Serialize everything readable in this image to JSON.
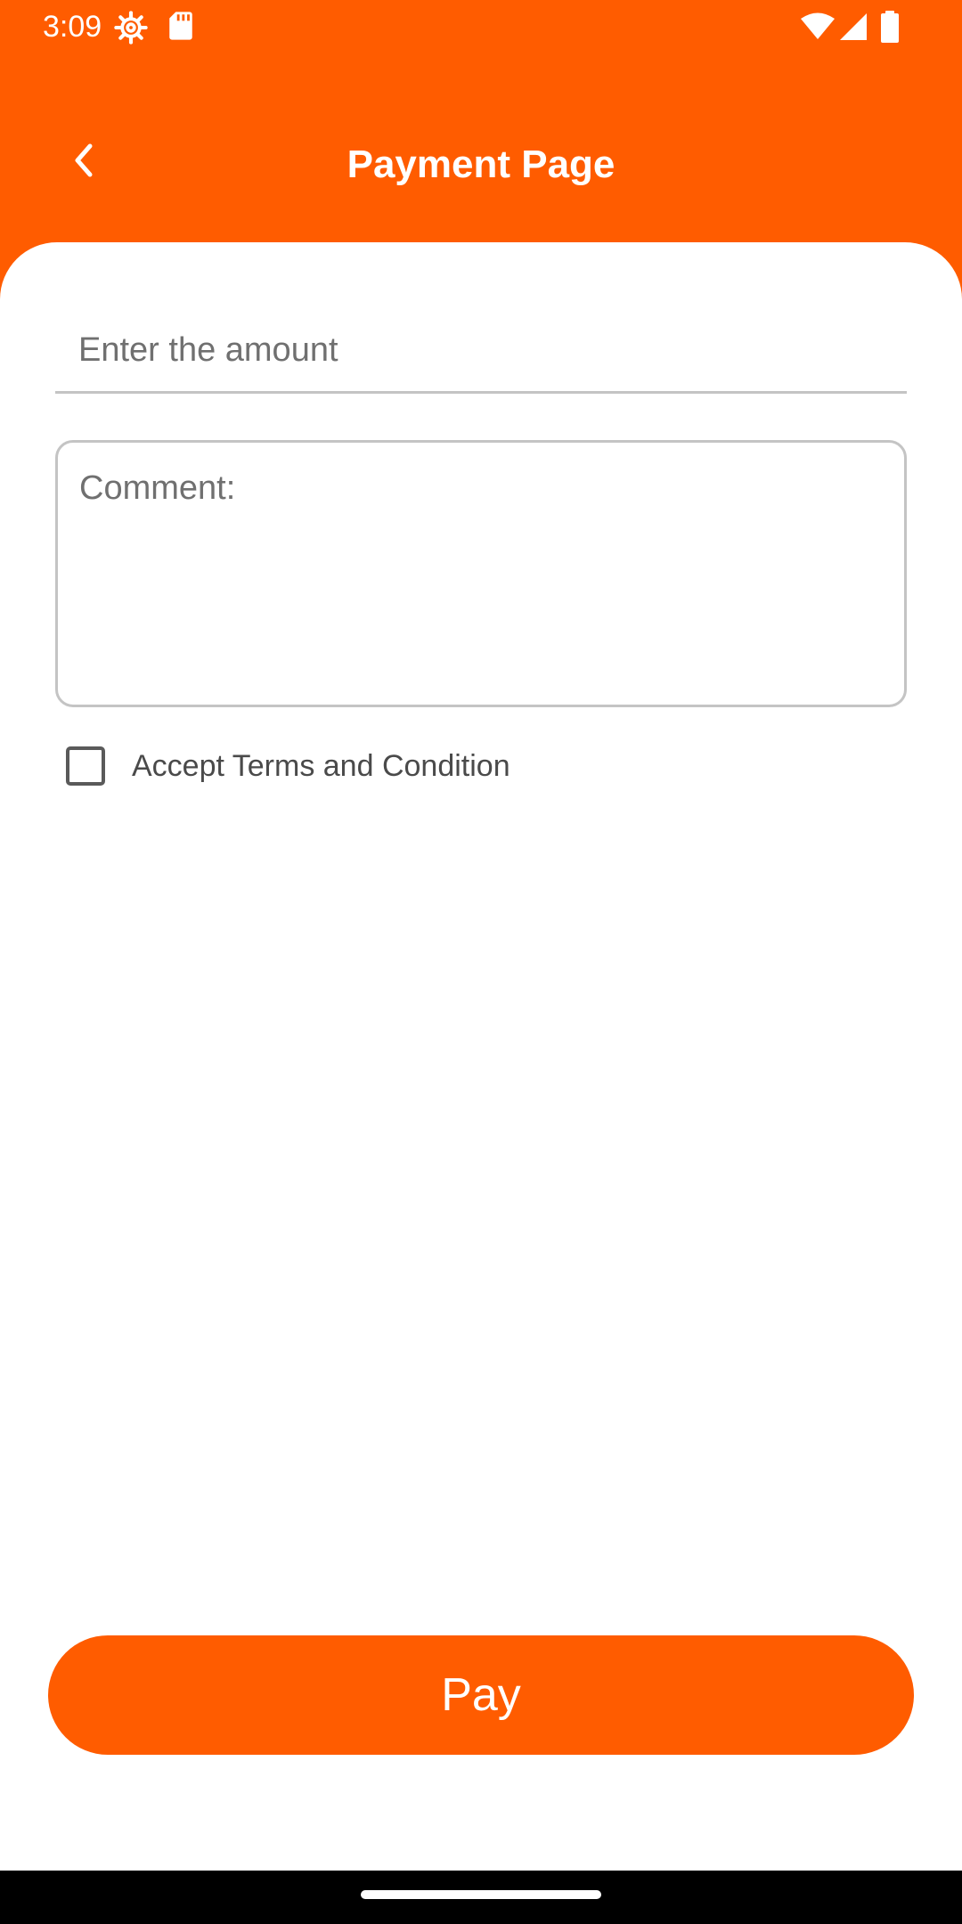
{
  "status_bar": {
    "time": "3:09",
    "left_icons": [
      "settings-gear-icon",
      "sd-card-icon"
    ],
    "right_icons": [
      "wifi-icon",
      "cell-signal-icon",
      "battery-icon"
    ]
  },
  "header": {
    "title": "Payment Page",
    "back_icon": "chevron-left-icon"
  },
  "form": {
    "amount": {
      "placeholder": "Enter the amount",
      "value": ""
    },
    "comment": {
      "placeholder": "Comment:",
      "value": ""
    },
    "terms": {
      "label": "Accept Terms and Condition",
      "checked": false
    }
  },
  "actions": {
    "pay_label": "Pay"
  },
  "colors": {
    "accent": "#FF5C00",
    "background": "#FFFFFF",
    "field_border": "#C4C4C4",
    "placeholder_text": "#707070",
    "nav_bar": "#000000"
  }
}
